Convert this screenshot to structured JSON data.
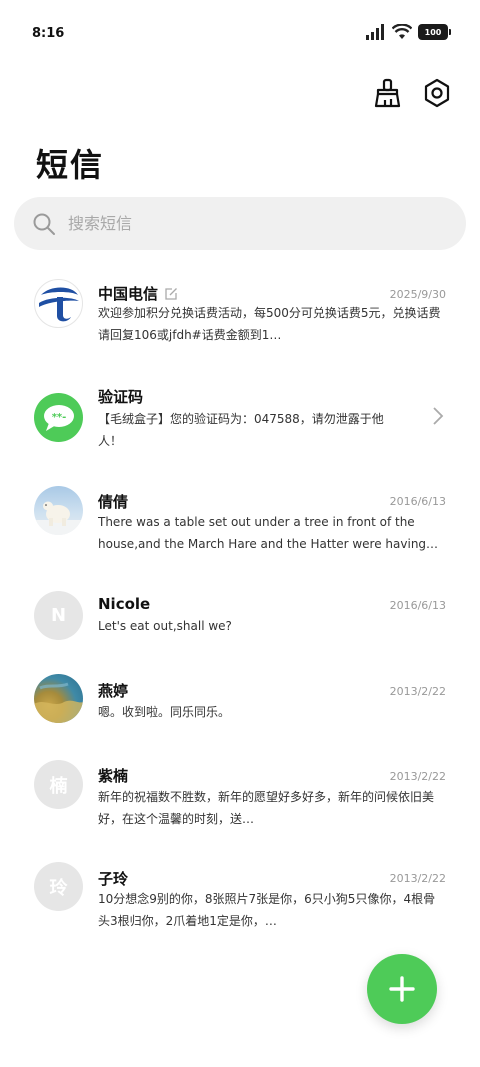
{
  "status": {
    "time": "8:16",
    "battery": "100"
  },
  "header": {
    "title": "短信"
  },
  "search": {
    "placeholder": "搜索短信"
  },
  "conversations": [
    {
      "name": "中国电信",
      "date": "2025/9/30",
      "preview": "欢迎参加积分兑换话费活动，每500分可兑换话费5元，兑换话费请回复106或jfdh#话费金额到1…"
    },
    {
      "name": "验证码",
      "date": "",
      "preview": "【毛绒盒子】您的验证码为：047588，请勿泄露于他人！"
    },
    {
      "name": "倩倩",
      "date": "2016/6/13",
      "preview": "There was a table set out under a tree in front of the house,and the March Hare and the Hatter were having t…"
    },
    {
      "name": "Nicole",
      "avatar": "N",
      "date": "2016/6/13",
      "preview": "Let's eat out,shall we?"
    },
    {
      "name": "燕婷",
      "date": "2013/2/22",
      "preview": "嗯。收到啦。同乐同乐。"
    },
    {
      "name": "紫楠",
      "avatar": "楠",
      "date": "2013/2/22",
      "preview": "新年的祝福数不胜数，新年的愿望好多好多，新年的问候依旧美好，在这个温馨的时刻，送…"
    },
    {
      "name": "子玲",
      "avatar": "玲",
      "date": "2013/2/22",
      "preview": "10分想念9别的你，8张照片7张是你，6只小狗5只像你，4根骨头3根归你，2爪着地1定是你，…"
    }
  ],
  "colors": {
    "accent": "#4ecb58",
    "telecom_blue": "#1f4fa3"
  }
}
